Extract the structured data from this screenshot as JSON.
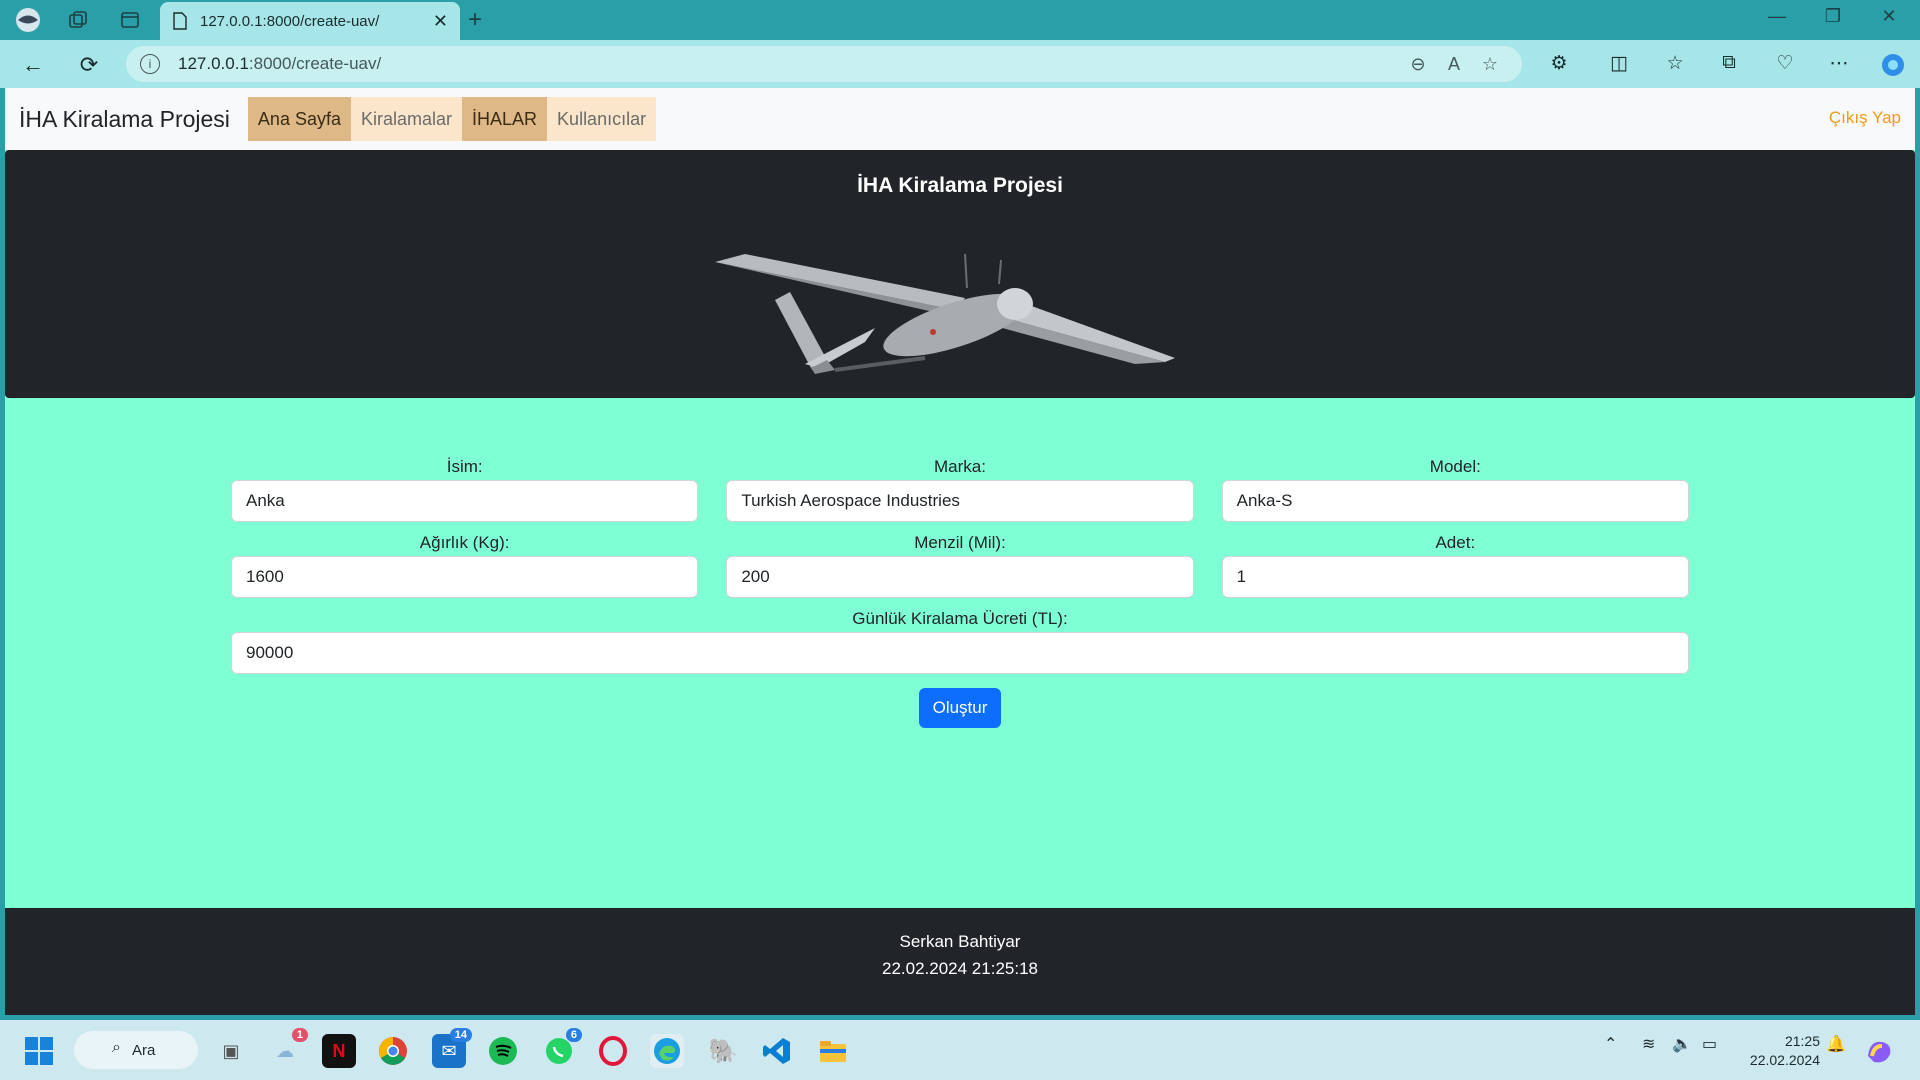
{
  "browser": {
    "tab_title": "127.0.0.1:8000/create-uav/",
    "tab_close": "✕",
    "new_tab": "+",
    "url_host": "127.0.0.1",
    "url_path": ":8000/create-uav/",
    "window_controls": [
      "—",
      "❐",
      "✕"
    ]
  },
  "navbar": {
    "brand": "İHA Kiralama Projesi",
    "links": [
      "Ana Sayfa",
      "Kiralamalar",
      "İHALAR",
      "Kullanıcılar"
    ],
    "logout": "Çıkış Yap"
  },
  "hero": {
    "title": "İHA Kiralama Projesi"
  },
  "form": {
    "name_label": "İsim:",
    "name_value": "Anka",
    "brand_label": "Marka:",
    "brand_value": "Turkish Aerospace Industries",
    "model_label": "Model:",
    "model_value": "Anka-S",
    "weight_label": "Ağırlık (Kg):",
    "weight_value": "1600",
    "range_label": "Menzil (Mil):",
    "range_value": "200",
    "count_label": "Adet:",
    "count_value": "1",
    "price_label": "Günlük Kiralama Ücreti (TL):",
    "price_value": "90000",
    "submit": "Oluştur"
  },
  "footer": {
    "author": "Serkan Bahtiyar",
    "datetime": "22.02.2024 21:25:18"
  },
  "taskbar": {
    "search": "Ara",
    "weather_badge": "1",
    "mail_badge": "14",
    "whatsapp_badge": "6",
    "time": "21:25",
    "date": "22.02.2024"
  },
  "colors": {
    "page_bg": "#7fffd4",
    "hero_bg": "#212529",
    "button": "#0d6efd",
    "logout": "#f09a1d",
    "nav_active": "#deb887"
  }
}
